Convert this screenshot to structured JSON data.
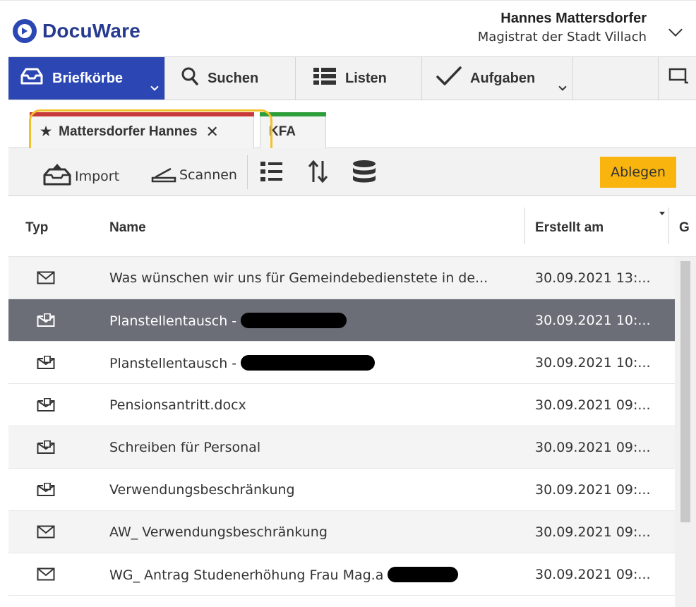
{
  "app": {
    "logo_text": "DocuWare"
  },
  "user": {
    "name": "Hannes Mattersdorfer",
    "org": "Magistrat der Stadt Villach"
  },
  "nav": {
    "items": [
      {
        "label": "Briefkörbe",
        "icon": "tray-icon",
        "active": true
      },
      {
        "label": "Suchen",
        "icon": "search-icon",
        "active": false
      },
      {
        "label": "Listen",
        "icon": "list-icon",
        "active": false
      },
      {
        "label": "Aufgaben",
        "icon": "check-icon",
        "active": false
      }
    ]
  },
  "tabs": [
    {
      "label": "Mattersdorfer Hannes",
      "color": "#c83a3a",
      "active": true
    },
    {
      "label": "KFA",
      "color": "#2e9e3a",
      "active": false
    }
  ],
  "toolbar": {
    "import_label": "Import",
    "scan_label": "Scannen",
    "store_label": "Ablegen",
    "store_color": "#f9b40d"
  },
  "table": {
    "columns": {
      "type": "Typ",
      "name": "Name",
      "created": "Erstellt am",
      "extra": "G"
    },
    "rows": [
      {
        "icon": "email-icon",
        "name": "Was wünschen wir uns für Gemeindebedienstete in de...",
        "date": "30.09.2021 13:..."
      },
      {
        "icon": "email-attachment-icon",
        "name": "Planstellentausch -",
        "date": "30.09.2021 10:...",
        "selected": true
      },
      {
        "icon": "email-attachment-icon",
        "name": "Planstellentausch -",
        "date": "30.09.2021 10:..."
      },
      {
        "icon": "email-attachment-icon",
        "name": "Pensionsantritt.docx",
        "date": "30.09.2021 09:..."
      },
      {
        "icon": "email-attachment-icon",
        "name": "Schreiben für Personal",
        "date": "30.09.2021 09:..."
      },
      {
        "icon": "email-attachment-icon",
        "name": "Verwendungsbeschränkung",
        "date": "30.09.2021 09:..."
      },
      {
        "icon": "email-icon",
        "name": "AW_ Verwendungsbeschränkung",
        "date": "30.09.2021 09:..."
      },
      {
        "icon": "email-icon",
        "name": "WG_ Antrag Studenerhöhung Frau Mag.a",
        "date": "30.09.2021 09:..."
      }
    ]
  }
}
